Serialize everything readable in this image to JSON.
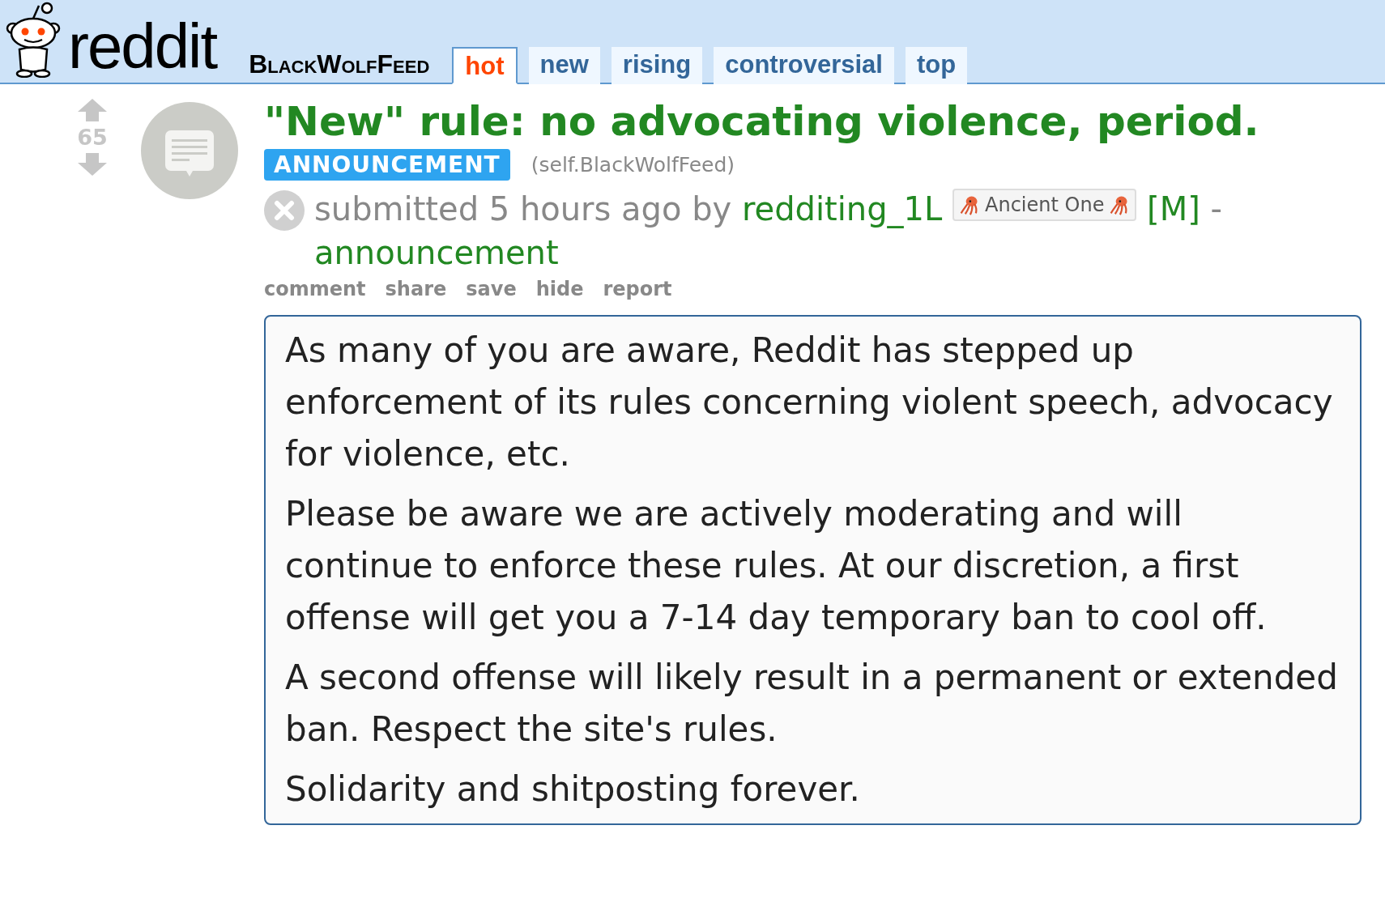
{
  "header": {
    "logo_text": "reddit",
    "subreddit": "BlackWolfFeed",
    "tabs": [
      {
        "label": "hot",
        "selected": true
      },
      {
        "label": "new",
        "selected": false
      },
      {
        "label": "rising",
        "selected": false
      },
      {
        "label": "controversial",
        "selected": false
      },
      {
        "label": "top",
        "selected": false
      }
    ]
  },
  "post": {
    "score": "65",
    "title": "\"New\" rule: no advocating violence, period.",
    "flair": "ANNOUNCEMENT",
    "domain": "(self.BlackWolfFeed)",
    "tagline": {
      "submitted": "submitted 5 hours ago by",
      "author": "redditing_1L",
      "user_flair": "Ancient One",
      "mod_marker": "[M]",
      "separator": "-",
      "link_flair": "announcement"
    },
    "buttons": [
      "comment",
      "share",
      "save",
      "hide",
      "report"
    ],
    "body": [
      "As many of you are aware, Reddit has stepped up enforcement of its rules concerning violent speech, advocacy for violence, etc.",
      "Please be aware we are actively moderating and will continue to enforce these rules. At our discretion, a first offense will get you a 7-14 day temporary ban to cool off.",
      "A second offense will likely result in a permanent or extended ban. Respect the site's rules.",
      "Solidarity and shitposting forever."
    ]
  }
}
